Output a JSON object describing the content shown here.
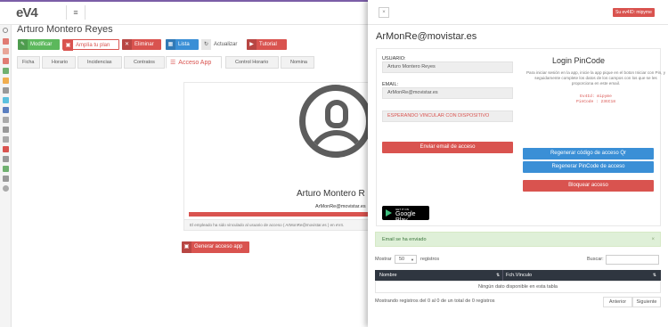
{
  "app": {
    "logo": "eV4",
    "menu_icon": "hamburger-icon"
  },
  "main": {
    "title": "Arturo Montero Reyes",
    "toolbar": {
      "modificar": "Modificar",
      "amplia": "Amplía tu plan",
      "eliminar": "Eliminar",
      "lista": "Lista",
      "actualizar": "Actualizar",
      "tutorial": "Tutorial"
    },
    "tabs": [
      "Ficha",
      "Horario",
      "Incidencias",
      "Contratos",
      "Acceso App",
      "Control Horario",
      "Nomina"
    ],
    "active_tab": "Acceso App",
    "card_name": "Arturo Montero R",
    "card_email": "ArMonRe@movistar.es",
    "notice": "El empleado ha sido vinculado al usuario de acceso ( ArMonRe@movistar.es ) en eV4.",
    "generate_button": "Generar acceso app"
  },
  "panel": {
    "close": "×",
    "badge": "Su ev4ID: mipyme",
    "title": "ArMonRe@movistar.es",
    "usuario_label": "USUARIO:",
    "usuario_value": "Arturo Montero Reyes",
    "email_label": "EMAIL:",
    "email_value": "ArMonRe@movistar.es",
    "status": "ESPERANDO VINCULAR CON DISPOSITIVO",
    "send_email": "Enviar email de acceso",
    "login_title": "Login PinCode",
    "login_desc": "Para iniciar sesión en la app, inicie la app pique en el boton Iniciar con Pin, y seguidamente complete los datos de los campos con los que se les proporciona en este email.",
    "ev4id_line": "Ev4Id: mipyme",
    "pincode_line": "PinCode : 23GC18",
    "regen_qr": "Regenerar código de acceso Qr",
    "regen_pin": "Regenerar PinCode de acceso",
    "block": "Bloquear acceso",
    "gplay_small": "GET IT ON",
    "gplay_big": "Google Play",
    "alert": "Email se ha enviado",
    "show_label": "Mostrar",
    "show_value": "50",
    "records_label": "registros",
    "search_label": "Buscar:",
    "table_headers": [
      "Nombre",
      "Fch.Vínculo"
    ],
    "empty_row": "Ningún dato disponible en esta tabla",
    "footer_info": "Mostrando registros del 0 al 0 de un total de 0 registros",
    "prev": "Anterior",
    "next": "Siguiente"
  },
  "colors": {
    "green": "#5cb85c",
    "red": "#d9534f",
    "blue": "#3a8fd6",
    "grey": "#e6e6e6",
    "dark": "#2f3640",
    "accent": "#7b5ea7"
  }
}
